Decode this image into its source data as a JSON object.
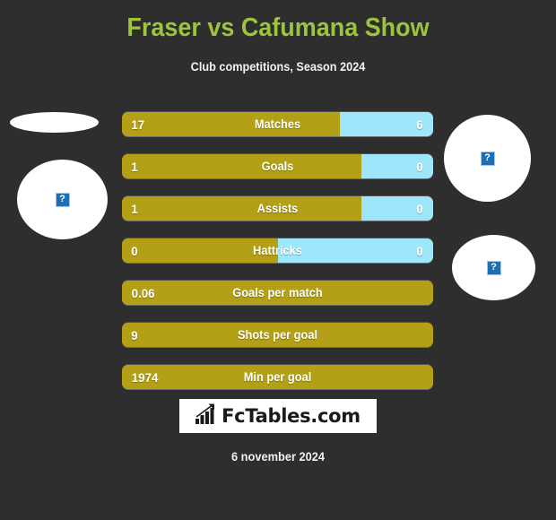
{
  "header": {
    "title": "Fraser vs Cafumana Show",
    "subtitle": "Club competitions, Season 2024",
    "title_color": "#9dc33f",
    "subtitle_color": "#f2f2f2"
  },
  "theme": {
    "background": "#2e2e2e",
    "home_color": "#b3a016",
    "away_color": "#9ee6f9",
    "value_text_color": "#ffffff"
  },
  "players": {
    "home": {
      "name": "Fraser",
      "photo_alt": "broken-image"
    },
    "away": {
      "name": "Cafumana Show",
      "photo_alt": "broken-image"
    }
  },
  "photos": [
    {
      "name": "home-photo-top",
      "alt": "broken-image",
      "has_icon": false
    },
    {
      "name": "home-photo-main",
      "alt": "broken-image",
      "has_icon": true
    },
    {
      "name": "away-photo-top",
      "alt": "broken-image",
      "has_icon": true
    },
    {
      "name": "away-photo-main",
      "alt": "broken-image",
      "has_icon": true
    }
  ],
  "chart_data": {
    "type": "bar",
    "title": "Fraser vs Cafumana Show",
    "subtitle": "Club competitions, Season 2024",
    "orientation": "horizontal-diverging",
    "series": [
      {
        "name": "Fraser",
        "color": "#b3a016"
      },
      {
        "name": "Cafumana Show",
        "color": "#9ee6f9"
      }
    ],
    "categories": [
      "Matches",
      "Goals",
      "Assists",
      "Hattricks",
      "Goals per match",
      "Shots per goal",
      "Min per goal"
    ],
    "rows": [
      {
        "label": "Matches",
        "home": "17",
        "away": "6",
        "home_pct": 70,
        "two_sided": true
      },
      {
        "label": "Goals",
        "home": "1",
        "away": "0",
        "home_pct": 77,
        "two_sided": true
      },
      {
        "label": "Assists",
        "home": "1",
        "away": "0",
        "home_pct": 77,
        "two_sided": true
      },
      {
        "label": "Hattricks",
        "home": "0",
        "away": "0",
        "home_pct": 50,
        "two_sided": true
      },
      {
        "label": "Goals per match",
        "home": "0.06",
        "away": "",
        "home_pct": 100,
        "two_sided": false
      },
      {
        "label": "Shots per goal",
        "home": "9",
        "away": "",
        "home_pct": 100,
        "two_sided": false
      },
      {
        "label": "Min per goal",
        "home": "1974",
        "away": "",
        "home_pct": 100,
        "two_sided": false
      }
    ]
  },
  "logo": {
    "text": "FcTables.com",
    "icon": "bar-chart-growth-icon"
  },
  "footer": {
    "date": "6 november 2024"
  }
}
